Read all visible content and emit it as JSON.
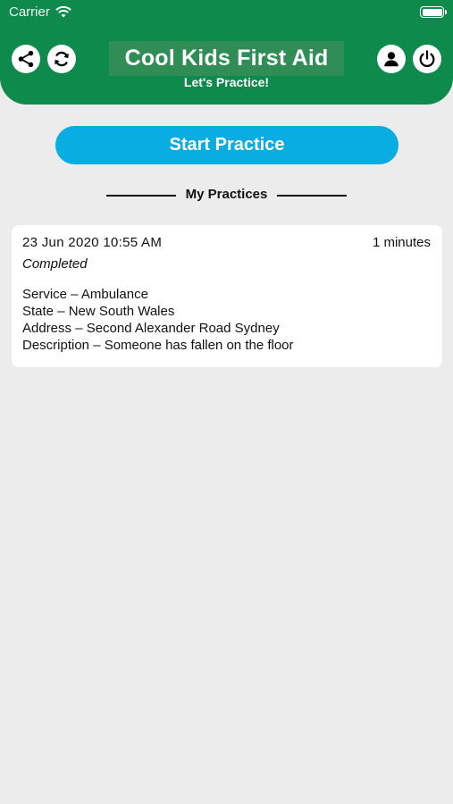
{
  "status_bar": {
    "carrier": "Carrier"
  },
  "header": {
    "title": "Cool Kids First Aid",
    "subtitle": "Let's Practice!",
    "icons": {
      "left": [
        "share-icon",
        "refresh-icon"
      ],
      "right": [
        "profile-icon",
        "power-icon"
      ]
    }
  },
  "start_button": {
    "label": "Start Practice"
  },
  "section": {
    "title": "My Practices"
  },
  "practices": [
    {
      "date": "23 Jun 2020 10:55 AM",
      "duration": "1 minutes",
      "status": "Completed",
      "details": [
        "Service – Ambulance",
        "State – New South Wales",
        "Address – Second Alexander Road Sydney",
        "Description – Someone has fallen on the floor"
      ]
    }
  ],
  "colors": {
    "header_green": "#0e8a4c",
    "title_bg": "#2f8d55",
    "button_blue": "#0aade2",
    "background": "#ececec"
  }
}
